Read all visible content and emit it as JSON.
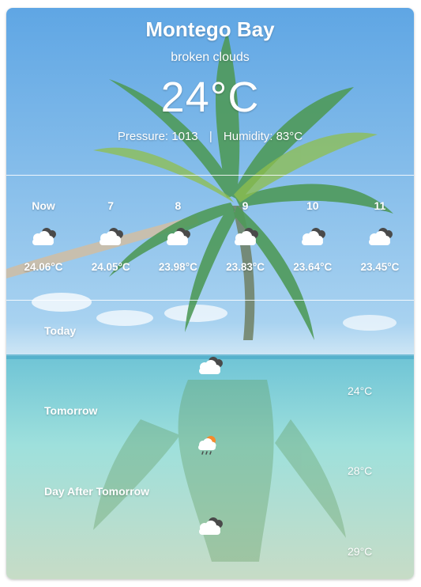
{
  "location": {
    "city": "Montego Bay"
  },
  "current": {
    "description": "broken clouds",
    "temperature": "24°C",
    "pressure": "Pressure: 1013",
    "separator": "|",
    "humidity": "Humidity: 83°C"
  },
  "hourly": [
    {
      "label": "Now",
      "temp": "24.06°C",
      "icon": "broken-clouds-icon"
    },
    {
      "label": "7",
      "temp": "24.05°C",
      "icon": "broken-clouds-icon"
    },
    {
      "label": "8",
      "temp": "23.98°C",
      "icon": "broken-clouds-icon"
    },
    {
      "label": "9",
      "temp": "23.83°C",
      "icon": "broken-clouds-icon"
    },
    {
      "label": "10",
      "temp": "23.64°C",
      "icon": "broken-clouds-icon"
    },
    {
      "label": "11",
      "temp": "23.45°C",
      "icon": "broken-clouds-icon"
    }
  ],
  "daily": [
    {
      "label": "Today",
      "temp": "24°C",
      "icon": "broken-clouds-icon"
    },
    {
      "label": "Tomorrow",
      "temp": "28°C",
      "icon": "sun-rain-cloud-icon"
    },
    {
      "label": "Day After Tomorrow",
      "temp": "29°C",
      "icon": "broken-clouds-icon"
    }
  ],
  "colors": {
    "text": "#ffffff",
    "sky_top": "#6aaee6",
    "sky_bottom": "#b8dcf2",
    "sea": "#7fd3d8",
    "sand": "#c9d7c0"
  }
}
